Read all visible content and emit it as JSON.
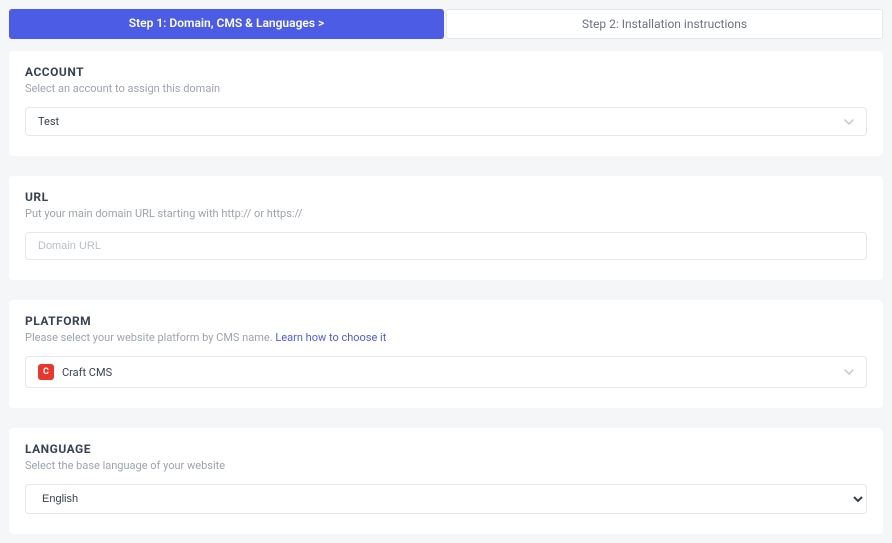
{
  "tabs": {
    "step1": "Step 1: Domain, CMS & Languages  >",
    "step2": "Step 2: Installation instructions"
  },
  "account": {
    "title": "ACCOUNT",
    "desc": "Select an account to assign this domain",
    "value": "Test"
  },
  "url": {
    "title": "URL",
    "desc": "Put your main domain URL starting with http:// or https://",
    "placeholder": "Domain URL"
  },
  "platform": {
    "title": "PLATFORM",
    "desc_prefix": "Please select your website platform by CMS name. ",
    "link": "Learn how to choose it",
    "badge_letter": "C",
    "value": "Craft CMS"
  },
  "language": {
    "title": "LANGUAGE",
    "desc": "Select the base language of your website",
    "value": "English"
  }
}
